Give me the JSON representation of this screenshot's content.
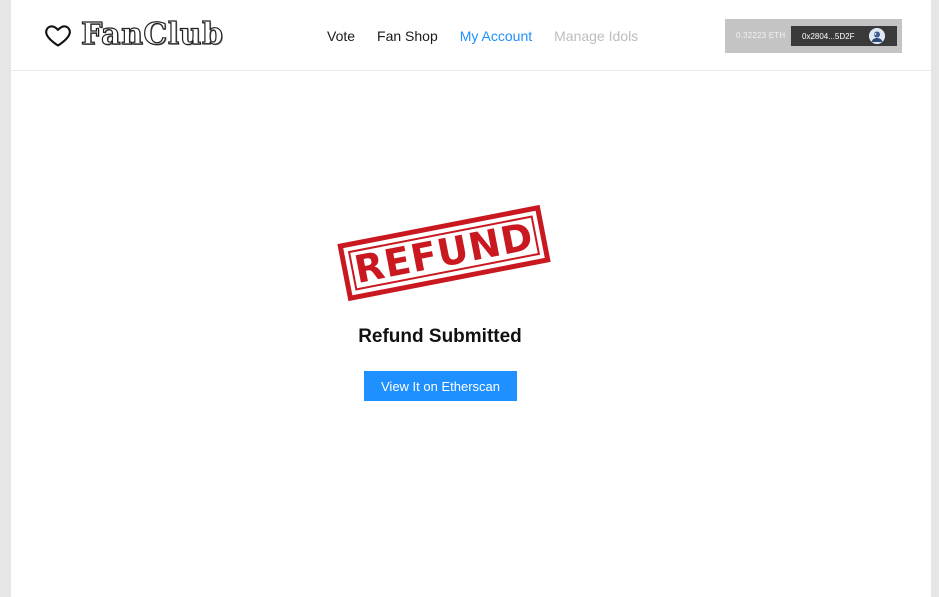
{
  "brand": {
    "name": "FanClub"
  },
  "nav": {
    "items": [
      {
        "label": "Vote",
        "state": "normal"
      },
      {
        "label": "Fan Shop",
        "state": "normal"
      },
      {
        "label": "My Account",
        "state": "active"
      },
      {
        "label": "Manage Idols",
        "state": "disabled"
      }
    ]
  },
  "wallet": {
    "balance": "0.32223 ETH",
    "address": "0x2804...5D2F"
  },
  "main": {
    "stamp_text": "REFUND",
    "title": "Refund Submitted",
    "button_label": "View It on Etherscan"
  },
  "colors": {
    "accent": "#1e90ff",
    "stamp_red": "#c9181f",
    "disabled": "#bdbdbd"
  }
}
